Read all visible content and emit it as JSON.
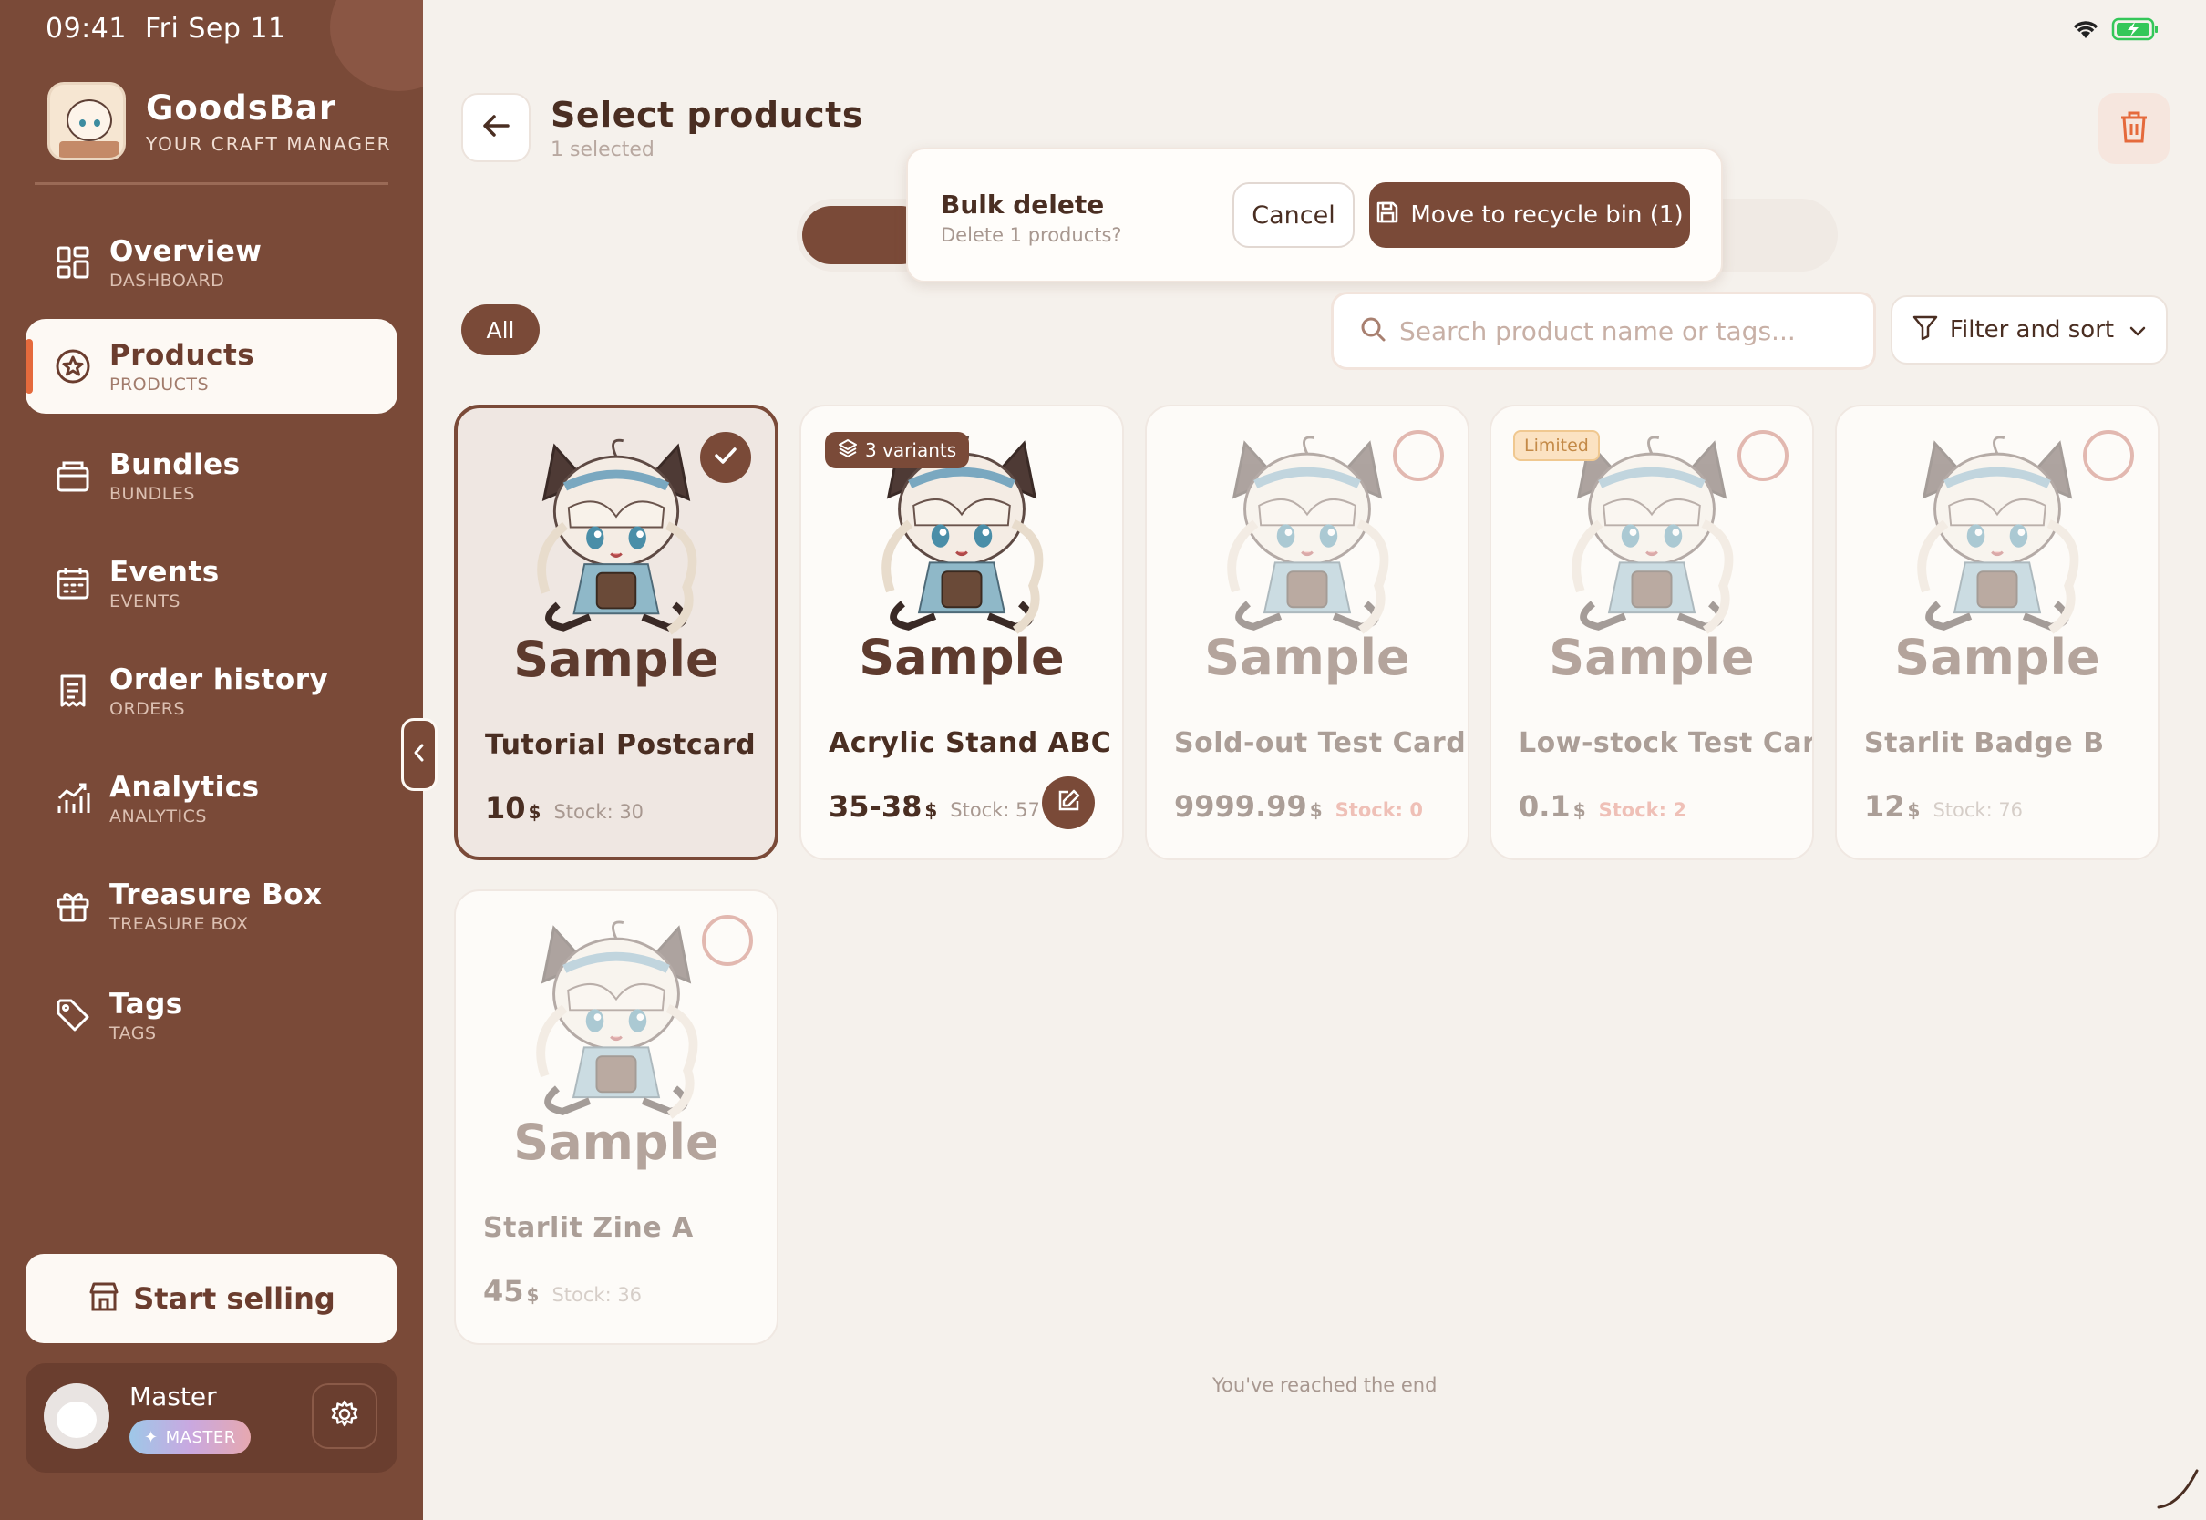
{
  "status_bar": {
    "time": "09:41",
    "date": "Fri Sep 11"
  },
  "brand": {
    "name": "GoodsBar",
    "tagline": "YOUR CRAFT MANAGER"
  },
  "nav": [
    {
      "label": "Overview",
      "sub": "DASHBOARD",
      "icon": "grid-icon",
      "active": false
    },
    {
      "label": "Products",
      "sub": "PRODUCTS",
      "icon": "star-badge-icon",
      "active": true
    },
    {
      "label": "Bundles",
      "sub": "BUNDLES",
      "icon": "box-icon",
      "active": false
    },
    {
      "label": "Events",
      "sub": "EVENTS",
      "icon": "calendar-icon",
      "active": false
    },
    {
      "label": "Order history",
      "sub": "ORDERS",
      "icon": "receipt-icon",
      "active": false
    },
    {
      "label": "Analytics",
      "sub": "ANALYTICS",
      "icon": "chart-icon",
      "active": false
    },
    {
      "label": "Treasure Box",
      "sub": "TREASURE BOX",
      "icon": "gift-icon",
      "active": false
    },
    {
      "label": "Tags",
      "sub": "TAGS",
      "icon": "tag-icon",
      "active": false
    }
  ],
  "start_selling": {
    "label": "Start selling"
  },
  "user": {
    "name": "Master",
    "badge": "MASTER"
  },
  "header": {
    "title": "Select products",
    "subtitle": "1 selected"
  },
  "bulk_delete": {
    "title": "Bulk delete",
    "description": "Delete 1 products?",
    "cancel_label": "Cancel",
    "confirm_label": "Move to recycle bin (1)"
  },
  "filters": {
    "chip_all": "All",
    "search_placeholder": "Search product name or tags...",
    "filter_label": "Filter and sort"
  },
  "products": [
    {
      "name": "Tutorial Postcard",
      "price": "10",
      "currency": "$",
      "stock": "Stock: 30",
      "thumb_text": "Sample",
      "selected": true,
      "faded": false
    },
    {
      "name": "Acrylic Stand ABC",
      "price": "35-38",
      "currency": "$",
      "stock": "Stock: 57",
      "thumb_text": "Sample",
      "badge": "3 variants",
      "selected": false,
      "faded": false
    },
    {
      "name": "Sold-out Test Card",
      "price": "9999.99",
      "currency": "$",
      "stock": "Stock: 0",
      "thumb_text": "Sample",
      "selected": false,
      "faded": true,
      "stock_warn": true
    },
    {
      "name": "Low-stock Test Card",
      "price": "0.1",
      "currency": "$",
      "stock": "Stock: 2",
      "thumb_text": "Sample",
      "badge": "Limited",
      "selected": false,
      "faded": true,
      "stock_warn": true
    },
    {
      "name": "Starlit Badge B",
      "price": "12",
      "currency": "$",
      "stock": "Stock: 76",
      "thumb_text": "Sample",
      "selected": false,
      "faded": true
    },
    {
      "name": "Starlit Zine A",
      "price": "45",
      "currency": "$",
      "stock": "Stock: 36",
      "thumb_text": "Sample",
      "selected": false,
      "faded": true
    }
  ],
  "end_message": "You've reached the end",
  "colors": {
    "primary": "#7a4a38",
    "background": "#f5f1ec",
    "accent": "#e56a3c",
    "warn": "#e07a6a"
  }
}
